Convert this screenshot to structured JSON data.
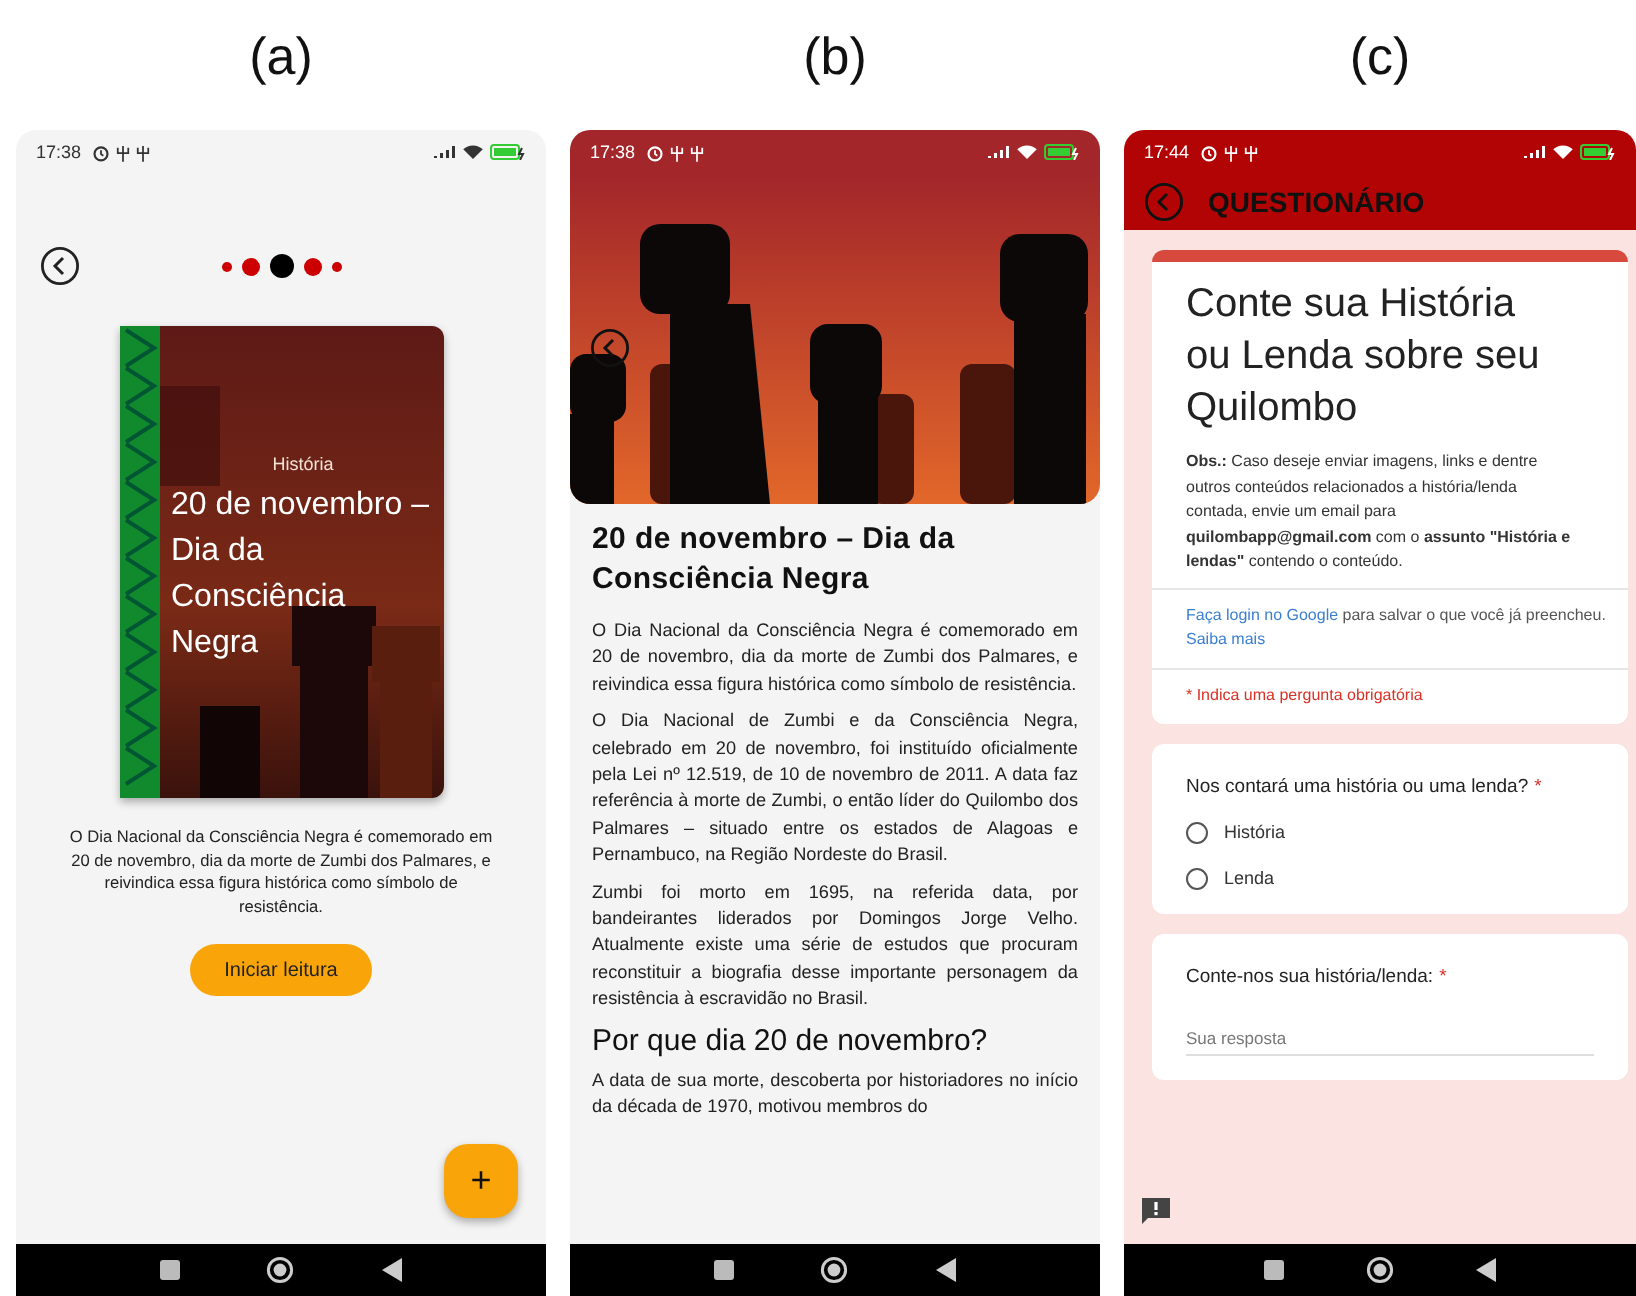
{
  "screens": [
    {
      "kind": "story_intro",
      "label": "(a)",
      "time": "17:38",
      "dots": [
        {
          "selected": false
        },
        {
          "selected": false
        },
        {
          "selected": true
        },
        {
          "selected": false
        },
        {
          "selected": false
        }
      ],
      "card": {
        "category": "História",
        "title": "20 de novembro – Dia da Consciência Negra"
      },
      "description": "O Dia Nacional da Consciência Negra é comemorado em 20 de novembro, dia da morte de Zumbi dos Palmares, e reivindica essa figura histórica como símbolo de resistência.",
      "button": "Iniciar leitura",
      "fab": "+"
    },
    {
      "kind": "story_reader",
      "label": "(b)",
      "time": "17:38",
      "title": "20 de novembro – Dia da Consciência Negra",
      "blocks": [
        {
          "kind": "paragraph",
          "text": "O Dia Nacional da Consciência Negra é comemorado em 20 de novembro, dia da morte de Zumbi dos Palmares, e reivindica essa figura histórica como símbolo de resistência."
        },
        {
          "kind": "paragraph",
          "text": "O Dia Nacional de Zumbi e da Consciência Negra, celebrado em 20 de novembro, foi instituído oficialmente pela Lei nº 12.519, de 10 de novembro de 2011. A data faz referência à morte de Zumbi, o então líder do Quilombo dos Palmares – situado entre os estados de Alagoas e Pernambuco, na Região Nordeste do Brasil."
        },
        {
          "kind": "paragraph",
          "text": "Zumbi foi morto em 1695, na referida data, por bandeirantes liderados por Domingos Jorge Velho. Atualmente existe uma série de estudos que procuram reconstituir a biografia desse importante personagem da resistência à escravidão no Brasil."
        },
        {
          "kind": "heading",
          "text": "Por que dia 20 de novembro?"
        },
        {
          "kind": "paragraph",
          "text": "A data de sua morte, descoberta por historiadores no início da década de 1970, motivou membros do"
        }
      ]
    },
    {
      "kind": "form",
      "label": "(c)",
      "time": "17:44",
      "header": "QUESTIONÁRIO",
      "form_title": "Conte sua História ou Lenda sobre seu Quilombo",
      "note": "**Obs.:** Caso deseje enviar imagens, links e dentre outros conteúdos relacionados a história/lenda contada, envie um email para **quilombapp@gmail.com** com o **assunto \"História e lendas\"** contendo o conteúdo.",
      "login_link": "Faça login no Google",
      "login_text": "para salvar o que você já preencheu.",
      "more_link": "Saiba mais",
      "required_note": "* Indica uma pergunta obrigatória",
      "questions": [
        {
          "kind": "radio",
          "text": "Nos contará uma história ou uma lenda?",
          "required_mark": "*",
          "options": [
            {
              "label": "História",
              "selected": false
            },
            {
              "label": "Lenda",
              "selected": false
            }
          ]
        },
        {
          "kind": "text",
          "text": "Conte-nos sua história/lenda:",
          "required_mark": "*",
          "placeholder": "Sua resposta"
        }
      ]
    }
  ]
}
